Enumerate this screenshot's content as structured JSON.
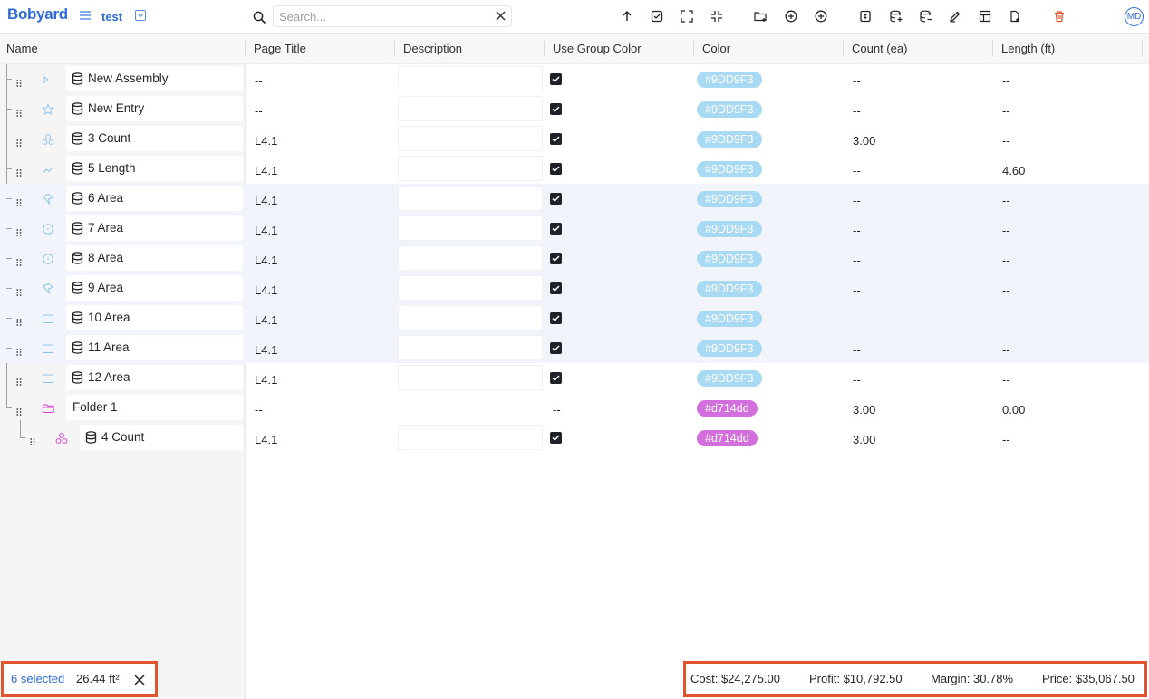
{
  "app": {
    "logo": "Bobyard",
    "project_name": "test",
    "avatar_initials": "MD"
  },
  "search": {
    "placeholder": "Search...",
    "value": ""
  },
  "toolbar": {
    "icons": [
      "arrow-up-icon",
      "check-square-icon",
      "expand-icon",
      "collapse-icon",
      "folder-add-icon",
      "add-circle-icon",
      "add-circle-alt-icon",
      "cost-sheet-icon",
      "add-row-icon",
      "remove-row-icon",
      "edit-icon",
      "table-add-icon",
      "file-add-icon",
      "delete-icon"
    ]
  },
  "columns": {
    "name": "Name",
    "page_title": "Page Title",
    "description": "Description",
    "use_group_color": "Use Group Color",
    "color": "Color",
    "count": "Count (ea)",
    "length": "Length (ft)"
  },
  "rows": [
    {
      "name": "New Assembly",
      "type_icon": "play-icon",
      "page": "--",
      "desc": "",
      "use_group_color": true,
      "color": "#9DD9F3",
      "count": "--",
      "length": "--",
      "selected": false
    },
    {
      "name": "New Entry",
      "type_icon": "star-icon",
      "page": "--",
      "desc": "",
      "use_group_color": true,
      "color": "#9DD9F3",
      "count": "--",
      "length": "--",
      "selected": false
    },
    {
      "name": "3 Count",
      "type_icon": "count-icon",
      "page": "L4.1",
      "desc": "",
      "use_group_color": true,
      "color": "#9DD9F3",
      "count": "3.00",
      "length": "--",
      "selected": false
    },
    {
      "name": "5 Length",
      "type_icon": "length-icon",
      "page": "L4.1",
      "desc": "",
      "use_group_color": true,
      "color": "#9DD9F3",
      "count": "--",
      "length": "4.60",
      "selected": false
    },
    {
      "name": "6 Area",
      "type_icon": "polygon-icon",
      "page": "L4.1",
      "desc": "",
      "use_group_color": true,
      "color": "#9DD9F3",
      "count": "--",
      "length": "--",
      "selected": true
    },
    {
      "name": "7 Area",
      "type_icon": "circle-area-icon",
      "page": "L4.1",
      "desc": "",
      "use_group_color": true,
      "color": "#9DD9F3",
      "count": "--",
      "length": "--",
      "selected": true
    },
    {
      "name": "8 Area",
      "type_icon": "circle-area-icon",
      "page": "L4.1",
      "desc": "",
      "use_group_color": true,
      "color": "#9DD9F3",
      "count": "--",
      "length": "--",
      "selected": true
    },
    {
      "name": "9 Area",
      "type_icon": "polygon-icon",
      "page": "L4.1",
      "desc": "",
      "use_group_color": true,
      "color": "#9DD9F3",
      "count": "--",
      "length": "--",
      "selected": true
    },
    {
      "name": "10 Area",
      "type_icon": "rectangle-icon",
      "page": "L4.1",
      "desc": "",
      "use_group_color": true,
      "color": "#9DD9F3",
      "count": "--",
      "length": "--",
      "selected": true
    },
    {
      "name": "11 Area",
      "type_icon": "rectangle-icon",
      "page": "L4.1",
      "desc": "",
      "use_group_color": true,
      "color": "#9DD9F3",
      "count": "--",
      "length": "--",
      "selected": true
    },
    {
      "name": "12 Area",
      "type_icon": "rectangle-icon",
      "page": "L4.1",
      "desc": "",
      "use_group_color": true,
      "color": "#9DD9F3",
      "count": "--",
      "length": "--",
      "selected": false
    },
    {
      "name": "Folder 1",
      "type_icon": "folder-icon",
      "page": "--",
      "desc": "--",
      "use_group_color": false,
      "color": "#d714dd",
      "count": "3.00",
      "length": "0.00",
      "selected": false,
      "is_folder": true
    },
    {
      "name": "4 Count",
      "type_icon": "count-icon",
      "page": "L4.1",
      "desc": "",
      "use_group_color": true,
      "color": "#d714dd",
      "count": "3.00",
      "length": "--",
      "selected": false,
      "child": true
    }
  ],
  "selection": {
    "count_label": "6 selected",
    "area": "26.44 ft²"
  },
  "summary": {
    "cost": "Cost: $24,275.00",
    "profit": "Profit: $10,792.50",
    "margin": "Margin: 30.78%",
    "price": "Price: $35,067.50"
  },
  "colors": {
    "accent": "#2e6bd8",
    "highlight": "#e0542f",
    "light_blue": "#9DD9F3",
    "magenta": "#d714dd"
  }
}
